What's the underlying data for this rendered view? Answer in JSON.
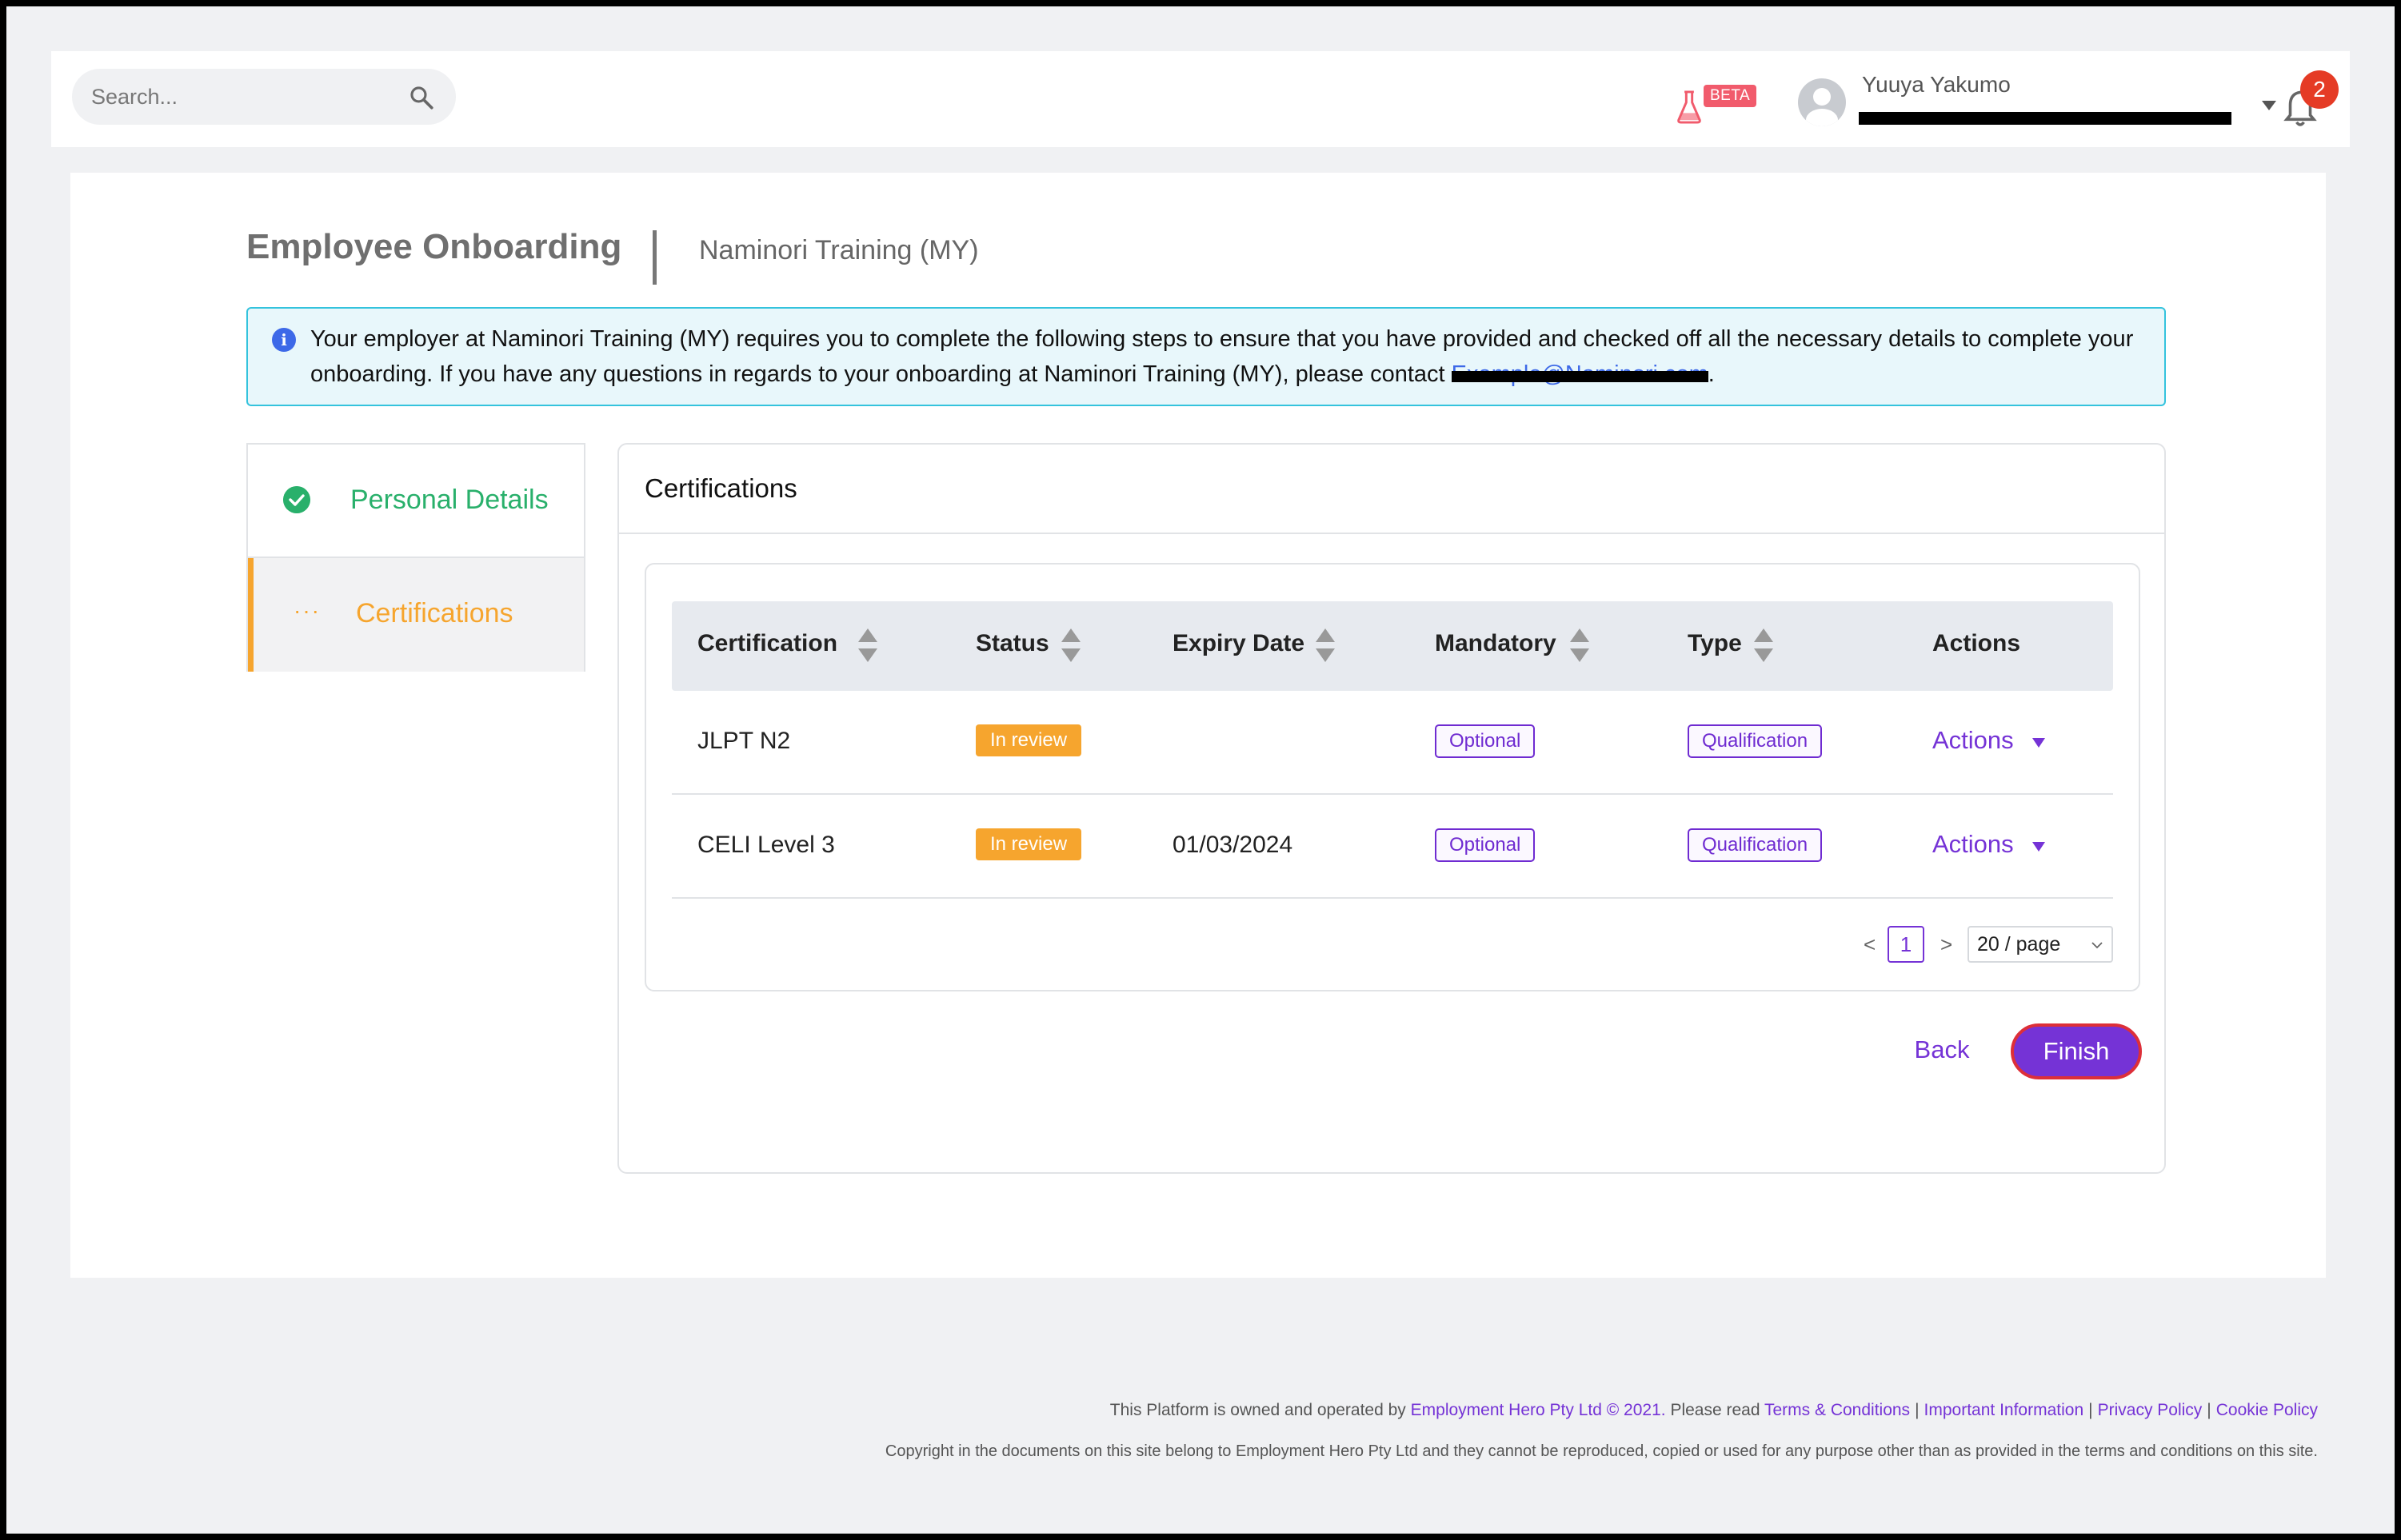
{
  "header": {
    "search_placeholder": "Search...",
    "beta_label": "BETA",
    "user_name": "Yuuya Yakumo",
    "notification_count": "2"
  },
  "page": {
    "title": "Employee Onboarding",
    "organization": "Naminori Training (MY)"
  },
  "info_banner": {
    "text": "Your employer at Naminori Training (MY) requires you to complete the following steps to ensure that you have provided and checked off all the necessary details to complete your onboarding. If you have any questions in regards to your onboarding at Naminori Training (MY), please contact ",
    "email": "Example@Naminori.com",
    "end": "."
  },
  "steps": [
    {
      "label": "Personal Details",
      "state": "complete"
    },
    {
      "label": "Certifications",
      "state": "in-progress"
    }
  ],
  "panel": {
    "title": "Certifications",
    "columns": [
      "Certification",
      "Status",
      "Expiry Date",
      "Mandatory",
      "Type",
      "Actions"
    ],
    "rows": [
      {
        "certification": "JLPT N2",
        "status": "In review",
        "expiry": "",
        "mandatory": "Optional",
        "type": "Qualification",
        "actions": "Actions"
      },
      {
        "certification": "CELI Level 3",
        "status": "In review",
        "expiry": "01/03/2024",
        "mandatory": "Optional",
        "type": "Qualification",
        "actions": "Actions"
      }
    ],
    "pagination": {
      "prev": "<",
      "current": "1",
      "next": ">",
      "page_size": "20 / page"
    },
    "back_label": "Back",
    "finish_label": "Finish"
  },
  "footer": {
    "line1_prefix": "This Platform is owned and operated by ",
    "company_link": "Employment Hero Pty Ltd © 2021.",
    "please_read": " Please read ",
    "terms_link": "Terms & Conditions",
    "important_link": "Important Information",
    "privacy_link": "Privacy Policy",
    "cookie_link": "Cookie Policy",
    "separator": "|",
    "line2": "Copyright in the documents on this site belong to Employment Hero Pty Ltd and they cannot be reproduced, copied or used for any purpose other than as provided in the terms and conditions on this site."
  },
  "colors": {
    "accent": "#7533d6",
    "success": "#29b06b",
    "warning": "#f6a52e",
    "info": "#3d69e8",
    "notification": "#e53b25"
  },
  "icons": {
    "search": "search-icon",
    "beta": "flask-icon",
    "user": "avatar-icon",
    "caret": "caret-down-icon",
    "notifications": "bell-icon",
    "info": "info-icon",
    "complete": "check-circle-icon",
    "in_progress": "ellipsis-icon",
    "sort": "sort-icon"
  }
}
